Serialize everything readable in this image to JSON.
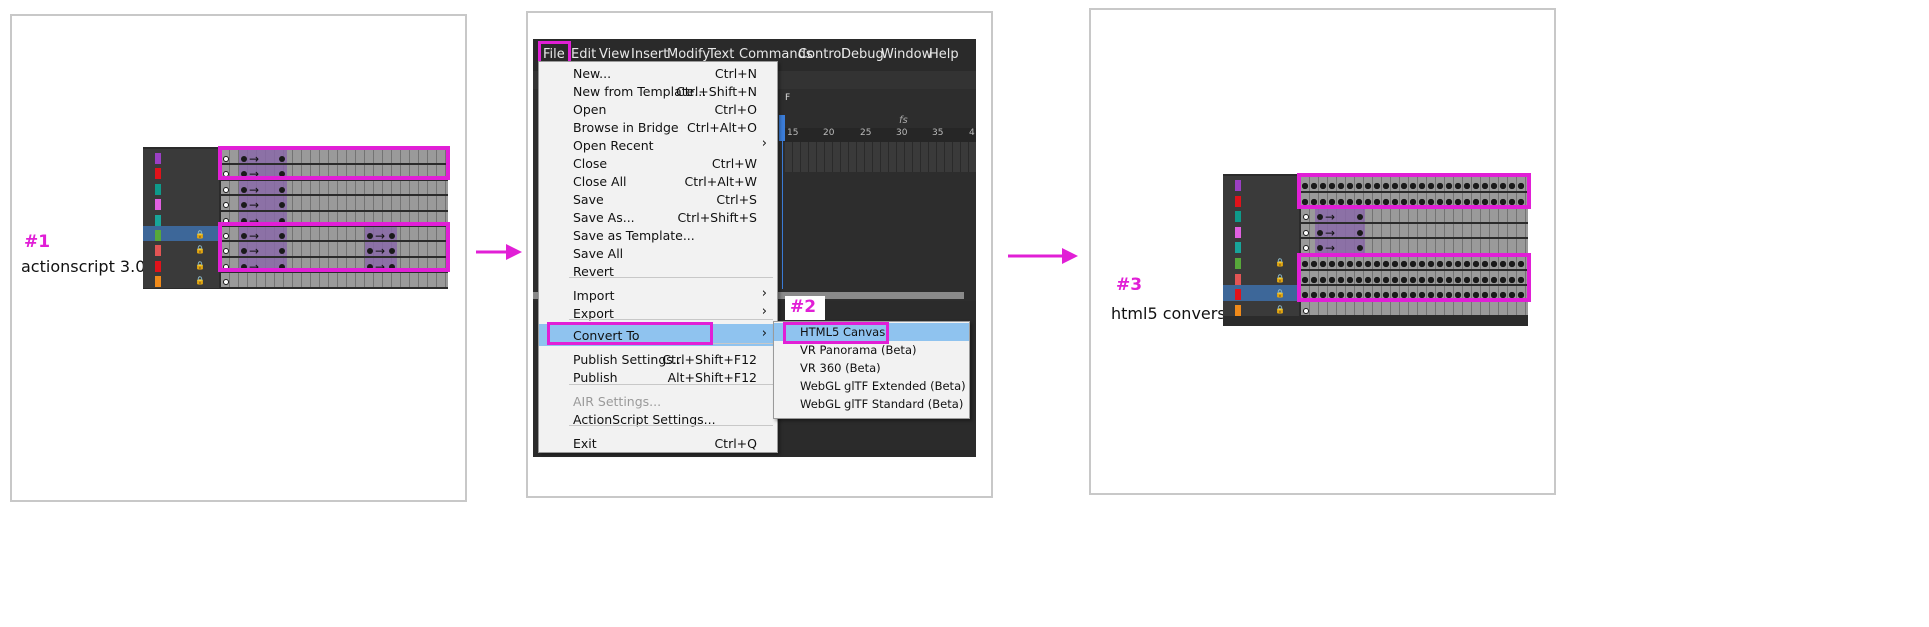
{
  "steps": [
    {
      "num": "#1",
      "label": "actionscript 3.0"
    },
    {
      "num": "#2",
      "label": ""
    },
    {
      "num": "#3",
      "label": "html5 convers"
    }
  ],
  "menubar": [
    "File",
    "Edit",
    "View",
    "Insert",
    "Modify",
    "Text",
    "Commands",
    "Control",
    "Debug",
    "Window",
    "Help"
  ],
  "timeline_header": {
    "f_marker": "F",
    "fps": "fs",
    "ticks": [
      "15",
      "20",
      "25",
      "30",
      "35",
      "4"
    ]
  },
  "file_menu": [
    {
      "label": "New...",
      "shortcut": "Ctrl+N"
    },
    {
      "label": "New from Template...",
      "shortcut": "Ctrl+Shift+N"
    },
    {
      "label": "Open",
      "shortcut": "Ctrl+O"
    },
    {
      "label": "Browse in Bridge",
      "shortcut": "Ctrl+Alt+O"
    },
    {
      "label": "Open Recent",
      "shortcut": "›"
    },
    {
      "label": "Close",
      "shortcut": "Ctrl+W"
    },
    {
      "label": "Close All",
      "shortcut": "Ctrl+Alt+W"
    },
    {
      "label": "Save",
      "shortcut": "Ctrl+S"
    },
    {
      "label": "Save As...",
      "shortcut": "Ctrl+Shift+S"
    },
    {
      "label": "Save as Template...",
      "shortcut": ""
    },
    {
      "label": "Save All",
      "shortcut": ""
    },
    {
      "label": "Revert",
      "shortcut": ""
    },
    {
      "label": "Import",
      "shortcut": "›"
    },
    {
      "label": "Export",
      "shortcut": "›"
    },
    {
      "label": "Convert To",
      "shortcut": "›"
    },
    {
      "label": "Publish Settings...",
      "shortcut": "Ctrl+Shift+F12"
    },
    {
      "label": "Publish",
      "shortcut": "Alt+Shift+F12"
    },
    {
      "label": "AIR Settings...",
      "shortcut": ""
    },
    {
      "label": "ActionScript Settings...",
      "shortcut": ""
    },
    {
      "label": "Exit",
      "shortcut": "Ctrl+Q"
    }
  ],
  "convert_submenu": [
    "HTML5 Canvas",
    "VR Panorama (Beta)",
    "VR 360 (Beta)",
    "WebGL glTF Extended (Beta)",
    "WebGL glTF Standard (Beta)"
  ],
  "layer_colors_1": [
    "#9b3fc4",
    "#e0121a",
    "#0e9a8a",
    "#e060e0",
    "#18a59a",
    "#57a83a",
    "#e25454",
    "#e0121a",
    "#f08a1a"
  ],
  "layer_colors_3": [
    "#9b3fc4",
    "#e0121a",
    "#0e9a8a",
    "#e060e0",
    "#18a59a",
    "#57a83a",
    "#e25454",
    "#e0121a",
    "#f08a1a"
  ],
  "colors": {
    "highlight": "#e11fd6",
    "menu_hover": "#8fc3ef",
    "selected_layer": "#3d6799"
  }
}
